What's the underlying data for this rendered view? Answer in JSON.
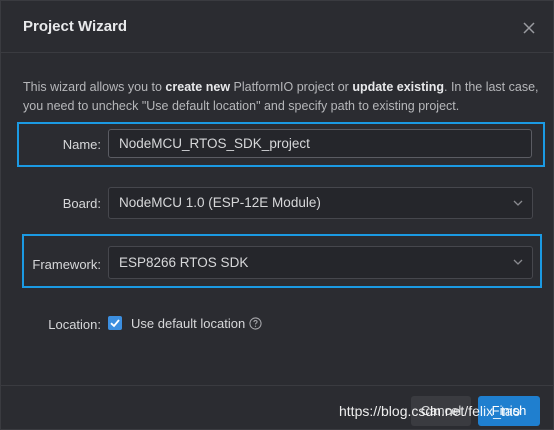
{
  "dialog": {
    "title": "Project Wizard"
  },
  "description": {
    "part1": "This wizard allows you to ",
    "bold1": "create new",
    "part2": " PlatformIO project or ",
    "bold2": "update existing",
    "part3": ". In the last case, you need to uncheck \"Use default location\" and specify path to existing project."
  },
  "form": {
    "name_label": "Name:",
    "name_value": "NodeMCU_RTOS_SDK_project",
    "board_label": "Board:",
    "board_value": "NodeMCU 1.0 (ESP-12E Module)",
    "framework_label": "Framework:",
    "framework_value": "ESP8266 RTOS SDK",
    "location_label": "Location:",
    "use_default_label": "Use default location",
    "use_default_checked": true
  },
  "buttons": {
    "cancel": "Cancel",
    "finish": "Finish"
  },
  "watermark": "https://blog.csdn.net/felix_tao",
  "colors": {
    "highlight": "#1b9ae3",
    "accent": "#1f7fcf",
    "background": "#2b2c31"
  },
  "icons": {
    "close": "close-icon",
    "chevron": "chevron-down-icon",
    "check": "check-icon",
    "help": "help-circle-icon"
  }
}
